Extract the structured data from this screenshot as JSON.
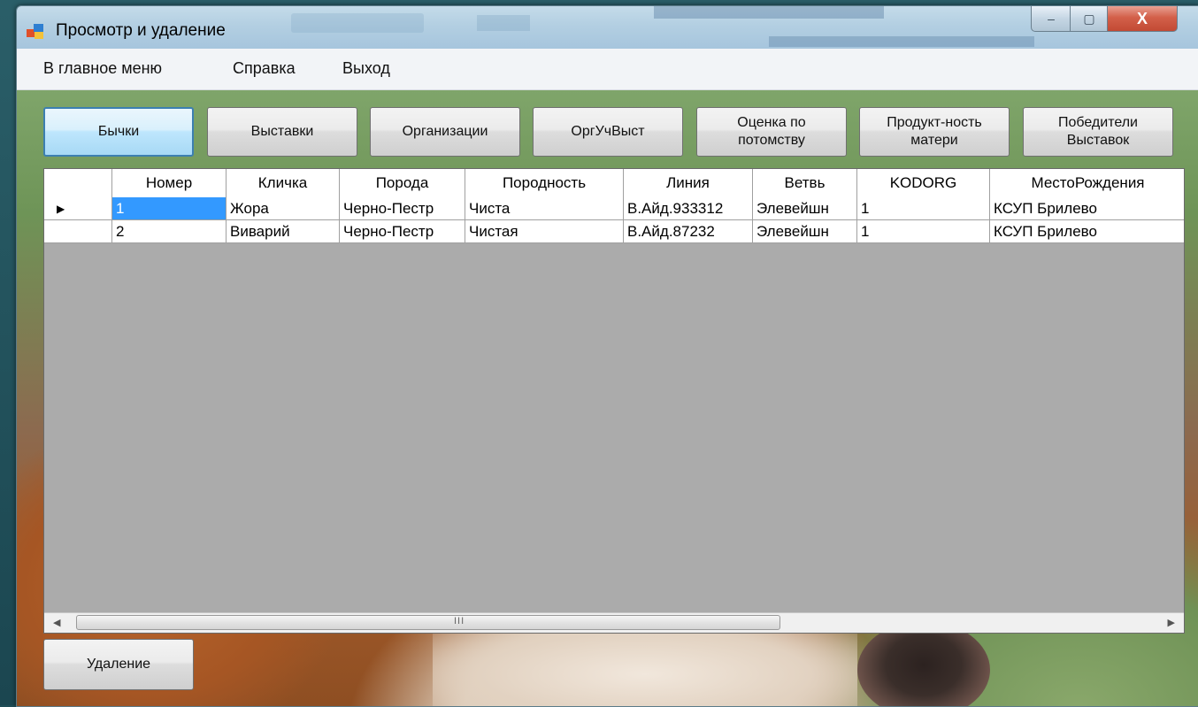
{
  "window": {
    "title": "Просмотр и удаление",
    "controls": {
      "minimize": "–",
      "maximize": "▢",
      "close": "X"
    }
  },
  "menu": {
    "items": [
      "В главное меню",
      "Справка",
      "Выход"
    ]
  },
  "toolbar": {
    "buttons": [
      "Бычки",
      "Выставки",
      "Организации",
      "ОргУчВыст",
      "Оценка по\nпотомству",
      "Продукт-ность\nматери",
      "Победители\nВыставок"
    ],
    "active_index": 0
  },
  "grid": {
    "columns": [
      "Номер",
      "Кличка",
      "Порода",
      "Породность",
      "Линия",
      "Ветвь",
      "KODORG",
      "МестоРождения"
    ],
    "rows": [
      [
        "1",
        "Жора",
        "Черно-Пестр",
        "Чиста",
        "В.Айд.933312",
        "Элевейшн",
        "1",
        "КСУП Брилево"
      ],
      [
        "2",
        "Виварий",
        "Черно-Пестр",
        "Чистая",
        "В.Айд.87232",
        "Элевейшн",
        "1",
        "КСУП Брилево"
      ]
    ],
    "current_row_marker": "▶",
    "selected_cell": {
      "row": 0,
      "col": 0
    },
    "scroll": {
      "left_arrow": "◀",
      "right_arrow": "▶",
      "grip": "III"
    }
  },
  "actions": {
    "delete_label": "Удаление"
  },
  "colors": {
    "selection": "#3399ff",
    "grid_background": "#ababab",
    "active_button_border": "#3c7fb1"
  }
}
